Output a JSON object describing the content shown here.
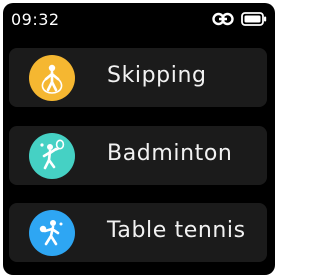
{
  "status_bar": {
    "time": "09:32",
    "icons": [
      "link-icon",
      "battery-icon"
    ]
  },
  "sports": [
    {
      "label": "Skipping",
      "icon": "skipping-rope-icon",
      "color": "#f5b731"
    },
    {
      "label": "Badminton",
      "icon": "badminton-icon",
      "color": "#45d1c4"
    },
    {
      "label": "Table tennis",
      "icon": "table-tennis-icon",
      "color": "#2ea6f3"
    }
  ],
  "colors": {
    "screen_background": "#000000",
    "item_background": "#1b1b1b",
    "text": "#f2f2f2"
  }
}
